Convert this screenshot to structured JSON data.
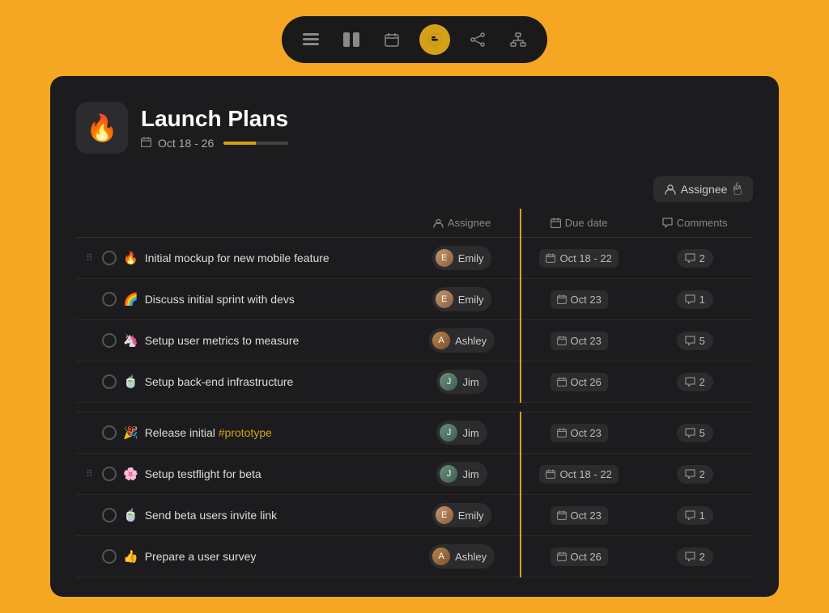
{
  "toolbar": {
    "icons": [
      {
        "name": "list-icon",
        "symbol": "≡",
        "active": false
      },
      {
        "name": "grid-icon",
        "symbol": "⊞",
        "active": false
      },
      {
        "name": "calendar-icon",
        "symbol": "⊡",
        "active": false
      },
      {
        "name": "timeline-icon",
        "symbol": "◑",
        "active": true
      },
      {
        "name": "share-icon",
        "symbol": "⊹",
        "active": false
      },
      {
        "name": "hierarchy-icon",
        "symbol": "⊟",
        "active": false
      }
    ]
  },
  "project": {
    "icon": "🔥",
    "title": "Launch Plans",
    "date_range": "Oct 18 - 26",
    "progress_pct": 50
  },
  "assignee_button": "Assignee",
  "table": {
    "headers": {
      "task": "",
      "assignee": "Assignee",
      "due_date": "Due date",
      "comments": "Comments"
    },
    "rows": [
      {
        "id": 1,
        "drag": true,
        "emoji": "🔥",
        "text": "Initial mockup for new mobile feature",
        "hashtag": null,
        "assignee": "Emily",
        "assignee_type": "emily",
        "due_date": "Oct 18 - 22",
        "comments": 2,
        "separator_before": false
      },
      {
        "id": 2,
        "drag": false,
        "emoji": "🌈",
        "text": "Discuss initial sprint with devs",
        "hashtag": null,
        "assignee": "Emily",
        "assignee_type": "emily",
        "due_date": "Oct 23",
        "comments": 1,
        "separator_before": false
      },
      {
        "id": 3,
        "drag": false,
        "emoji": "🦄",
        "text": "Setup user metrics to measure",
        "hashtag": null,
        "assignee": "Ashley",
        "assignee_type": "ashley",
        "due_date": "Oct 23",
        "comments": 5,
        "separator_before": false
      },
      {
        "id": 4,
        "drag": false,
        "emoji": "🍵",
        "text": "Setup back-end infrastructure",
        "hashtag": null,
        "assignee": "Jim",
        "assignee_type": "jim",
        "due_date": "Oct 26",
        "comments": 2,
        "separator_before": false
      },
      {
        "id": 5,
        "drag": false,
        "emoji": "🎉",
        "text": "Release initial ",
        "hashtag": "#prototype",
        "assignee": "Jim",
        "assignee_type": "jim",
        "due_date": "Oct 23",
        "comments": 5,
        "separator_before": true
      },
      {
        "id": 6,
        "drag": true,
        "emoji": "🌸",
        "text": "Setup testflight for beta",
        "hashtag": null,
        "assignee": "Jim",
        "assignee_type": "jim",
        "due_date": "Oct 18 - 22",
        "comments": 2,
        "separator_before": false
      },
      {
        "id": 7,
        "drag": false,
        "emoji": "🍵",
        "text": "Send beta users invite link",
        "hashtag": null,
        "assignee": "Emily",
        "assignee_type": "emily",
        "due_date": "Oct 23",
        "comments": 1,
        "separator_before": false
      },
      {
        "id": 8,
        "drag": false,
        "emoji": "👍",
        "text": "Prepare a user survey",
        "hashtag": null,
        "assignee": "Ashley",
        "assignee_type": "ashley",
        "due_date": "Oct 26",
        "comments": 2,
        "separator_before": false
      }
    ]
  }
}
